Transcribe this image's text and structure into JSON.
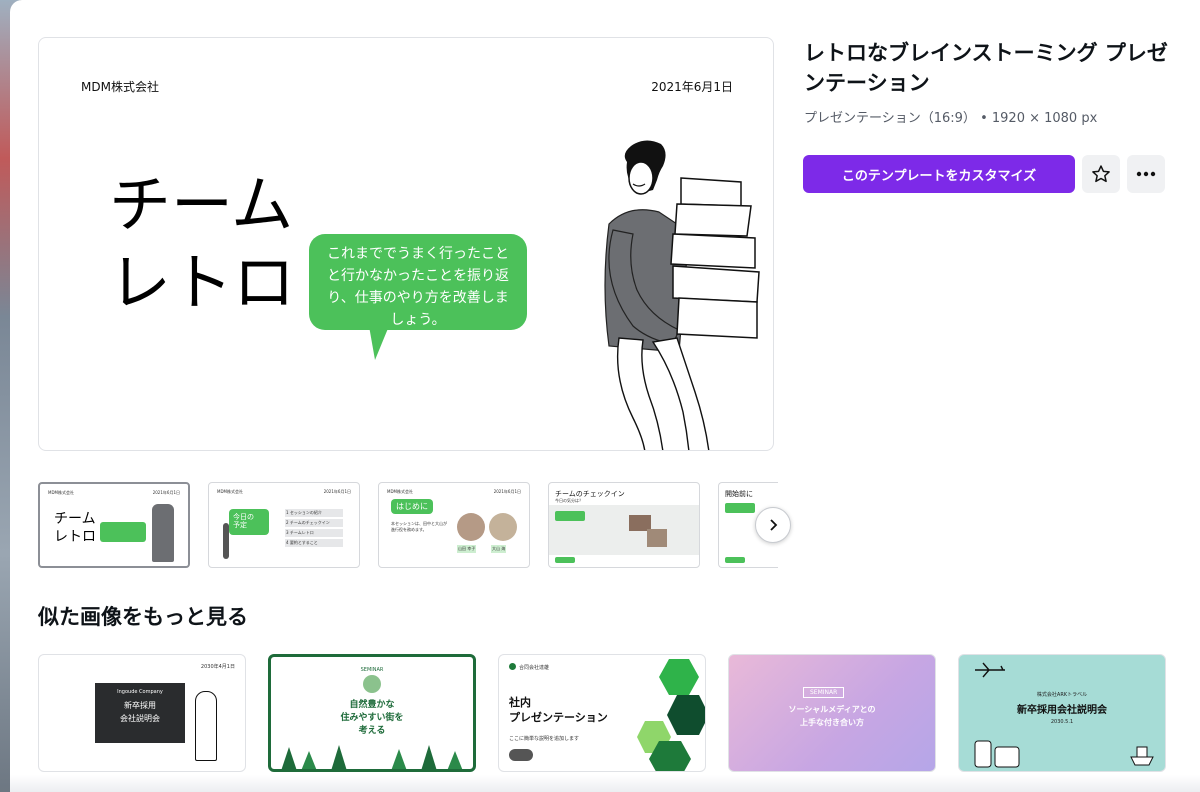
{
  "preview": {
    "company": "MDM株式会社",
    "date": "2021年6月1日",
    "title": "チーム\nレトロ",
    "bubble": "これまででうまく行ったことと行かなかったことを振り返り、仕事のやり方を改善しましょう。"
  },
  "template": {
    "title": "レトロなブレインストーミング プレゼンテーション",
    "type": "プレゼンテーション（16:9）",
    "size": "• 1920 × 1080 px",
    "customize_label": "このテンプレートをカスタマイズ",
    "star_icon": "star-icon",
    "more_icon": "more-icon"
  },
  "thumbnails": [
    {
      "company": "MDM株式会社",
      "date": "2021年6月1日",
      "title": "チーム\nレトロ"
    },
    {
      "company": "MDM株式会社",
      "date": "2021年6月1日",
      "title": "今日の\n予定",
      "items": [
        "1 セッションの紹介",
        "2 チームのチェックイン",
        "3 チームレトロ",
        "4 要約とすること"
      ]
    },
    {
      "company": "MDM株式会社",
      "date": "2021年6月1日",
      "title": "はじめに",
      "body": "本セッションは、田中と大山が進行役を務めます。",
      "names": [
        "山田 幸子",
        "大山 海"
      ]
    },
    {
      "title": "チームのチェックイン",
      "subtitle": "今日の気分は？"
    },
    {
      "title": "開始前に"
    }
  ],
  "section_title": "似た画像をもっと見る",
  "similar": [
    {
      "date": "2030年4月1日",
      "company": "Ingoude Company",
      "title": "新卒採用\n会社説明会"
    },
    {
      "label": "SEMINAR",
      "title": "自然豊かな\n住みやすい街を\n考える"
    },
    {
      "company": "合同会社達雄",
      "title": "社内\nプレゼンテーション",
      "subtitle": "ここに簡単な説明を追加します"
    },
    {
      "label": "SEMINAR",
      "title": "ソーシャルメディアとの\n上手な付き合い方"
    },
    {
      "company": "株式会社ARKトラベル",
      "title": "新卒採用会社説明会",
      "date": "2030.5.1"
    }
  ],
  "colors": {
    "accent": "#7d2ae8",
    "green": "#4cc15a",
    "forest": "#1e6b3a"
  }
}
